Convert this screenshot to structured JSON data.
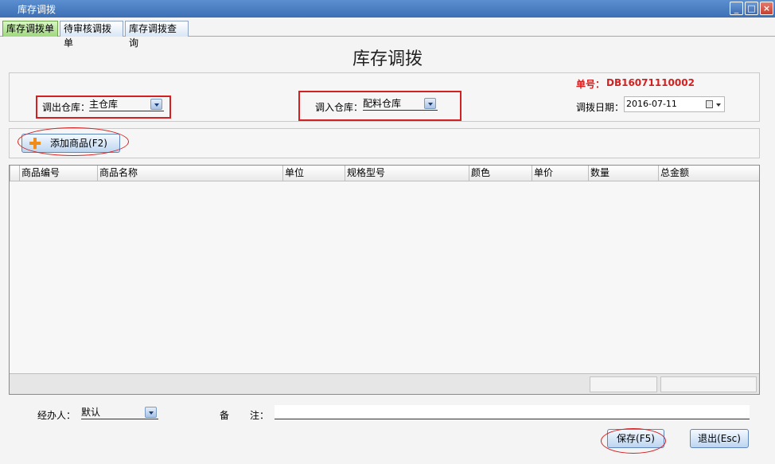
{
  "window": {
    "title": "库存调拨"
  },
  "tabs": [
    {
      "label": "库存调拨单",
      "active": true
    },
    {
      "label": "待审核调拨单",
      "active": false
    },
    {
      "label": "库存调拨查询",
      "active": false
    }
  ],
  "form": {
    "heading": "库存调拨",
    "order_label": "单号：",
    "order_no": "DB16071110002",
    "out_warehouse_label": "调出仓库：",
    "out_warehouse_value": "主仓库",
    "in_warehouse_label": "调入仓库：",
    "in_warehouse_value": "配料仓库",
    "date_label": "调拨日期：",
    "date_value": "2016-07-11"
  },
  "toolbar": {
    "add_product_label": "添加商品(F2)"
  },
  "table": {
    "columns": [
      "商品编号",
      "商品名称",
      "单位",
      "规格型号",
      "颜色",
      "单价",
      "数量",
      "总金额"
    ],
    "rows": []
  },
  "footer": {
    "handler_label": "经办人：",
    "handler_value": "默认",
    "note_label_1": "备",
    "note_label_2": "注：",
    "note_value": "",
    "save_label": "保存(F5)",
    "exit_label": "退出(Esc)"
  },
  "colors": {
    "accent_red": "#d42020",
    "titlebar_blue": "#3c6fb4",
    "active_tab_green": "#9fd77f"
  }
}
